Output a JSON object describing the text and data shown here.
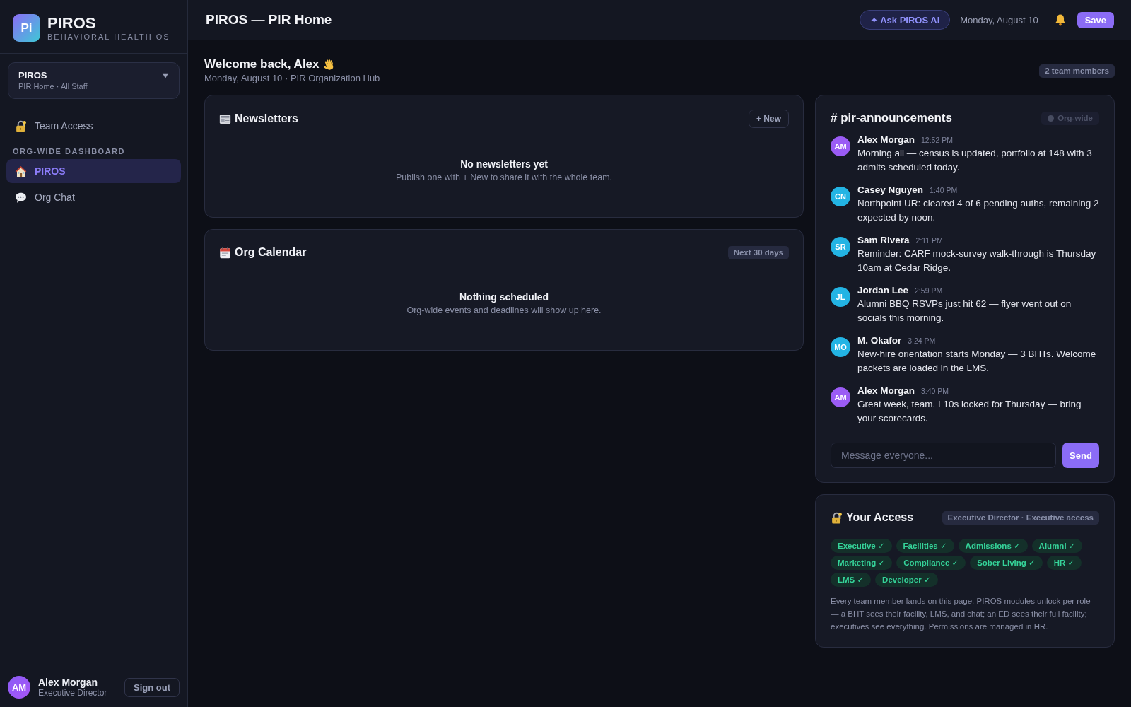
{
  "sidebar": {
    "brand": {
      "logo_text": "Pi",
      "name": "PIROS",
      "tagline": "BEHAVIORAL HEALTH OS"
    },
    "org_switcher": {
      "title": "PIROS",
      "subtitle": "PIR Home · All Staff"
    },
    "links": [
      {
        "label": "Team Access",
        "selected": false
      }
    ],
    "sections": [
      {
        "title": "ORG-WIDE DASHBOARD",
        "items": [
          {
            "label": "PIROS",
            "selected": true
          },
          {
            "label": "Org Chat",
            "selected": false
          }
        ]
      }
    ],
    "user": {
      "initials": "AM",
      "name": "Alex Morgan",
      "role": "Executive Director",
      "sign_out": "Sign out"
    }
  },
  "header": {
    "title": "PIROS — PIR Home",
    "ai_button": "✦ Ask PIROS AI",
    "date": "Monday, August 10",
    "save_button": "Save"
  },
  "welcome": {
    "title": "Welcome back, Alex",
    "subtitle": "Monday, August 10 · PIR Organization Hub",
    "badge": "2 team members"
  },
  "newsletters": {
    "title": "Newsletters",
    "new_button": "+ New",
    "empty_title": "No newsletters yet",
    "empty_text": "Publish one with + New to share it with the whole team."
  },
  "calendar": {
    "title": "Org Calendar",
    "badge": "Next 30 days",
    "empty_title": "Nothing scheduled",
    "empty_text": "Org-wide events and deadlines will show up here."
  },
  "chat": {
    "channel": "# pir-announcements",
    "badge": "Org-wide",
    "messages": [
      {
        "initials": "AM",
        "author": "Alex Morgan",
        "time": "12:52 PM",
        "text": "Morning all — census is updated, portfolio at 148 with 3 admits scheduled today.",
        "color": "#9b5cf5"
      },
      {
        "initials": "CN",
        "author": "Casey Nguyen",
        "time": "1:40 PM",
        "text": "Northpoint UR: cleared 4 of 6 pending auths, remaining 2 expected by noon.",
        "color": "#23b4e4"
      },
      {
        "initials": "SR",
        "author": "Sam Rivera",
        "time": "2:11 PM",
        "text": "Reminder: CARF mock-survey walk-through is Thursday 10am at Cedar Ridge.",
        "color": "#23b4e4"
      },
      {
        "initials": "JL",
        "author": "Jordan Lee",
        "time": "2:59 PM",
        "text": "Alumni BBQ RSVPs just hit 62 — flyer went out on socials this morning.",
        "color": "#23b4e4"
      },
      {
        "initials": "MO",
        "author": "M. Okafor",
        "time": "3:24 PM",
        "text": "New-hire orientation starts Monday — 3 BHTs. Welcome packets are loaded in the LMS.",
        "color": "#23b4e4"
      },
      {
        "initials": "AM",
        "author": "Alex Morgan",
        "time": "3:40 PM",
        "text": "Great week, team. L10s locked for Thursday — bring your scorecards.",
        "color": "#9b5cf5"
      }
    ],
    "input": {
      "placeholder": "Message everyone..."
    },
    "send_button": "Send"
  },
  "access": {
    "title": "Your Access",
    "role_badge": "Executive Director · Executive access",
    "modules": [
      {
        "label": "Executive ✓"
      },
      {
        "label": "Facilities ✓"
      },
      {
        "label": "Admissions ✓"
      },
      {
        "label": "Alumni ✓"
      },
      {
        "label": "Marketing ✓"
      },
      {
        "label": "Compliance ✓"
      },
      {
        "label": "Sober Living ✓"
      },
      {
        "label": "HR ✓"
      },
      {
        "label": "LMS ✓"
      },
      {
        "label": "Developer ✓"
      }
    ],
    "note": "Every team member lands on this page. PIROS modules unlock per role — a BHT sees their facility, LMS, and chat; an ED sees their full facility; executives see everything. Permissions are managed in HR."
  }
}
